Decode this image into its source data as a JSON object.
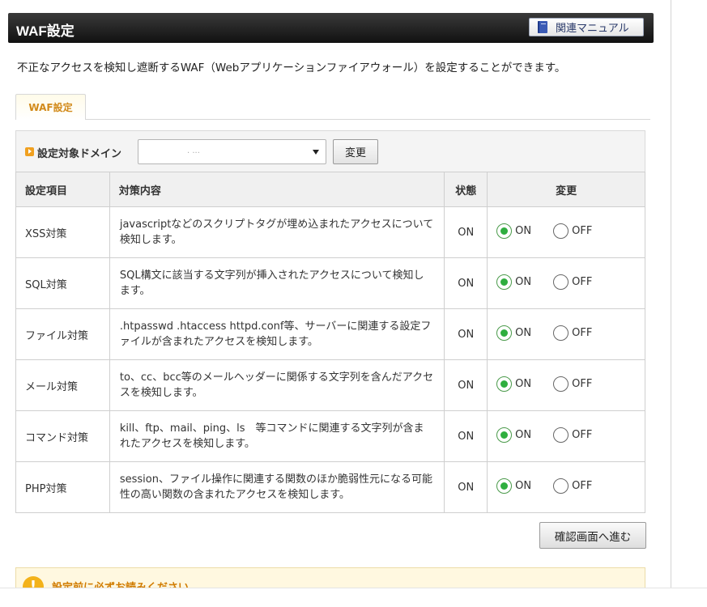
{
  "header": {
    "title": "WAF設定",
    "manual_button": "関連マニュアル"
  },
  "description": "不正なアクセスを検知し遮断するWAF（Webアプリケーションファイアウォール）を設定することができます。",
  "tab": {
    "label": "WAF設定"
  },
  "domain": {
    "label": "設定対象ドメイン",
    "selected": ". ...",
    "change_button": "変更"
  },
  "table": {
    "headers": [
      "設定項目",
      "対策内容",
      "状態",
      "変更"
    ],
    "rows": [
      {
        "item": "XSS対策",
        "desc": "javascriptなどのスクリプトタグが埋め込まれたアクセスについて検知します。",
        "status": "ON",
        "selected": "ON"
      },
      {
        "item": "SQL対策",
        "desc": "SQL構文に該当する文字列が挿入されたアクセスについて検知します。",
        "status": "ON",
        "selected": "ON"
      },
      {
        "item": "ファイル対策",
        "desc": ".htpasswd .htaccess httpd.conf等、サーバーに関連する設定ファイルが含まれたアクセスを検知します。",
        "status": "ON",
        "selected": "ON"
      },
      {
        "item": "メール対策",
        "desc": "to、cc、bcc等のメールヘッダーに関係する文字列を含んだアクセスを検知します。",
        "status": "ON",
        "selected": "ON"
      },
      {
        "item": "コマンド対策",
        "desc": "kill、ftp、mail、ping、ls　等コマンドに関連する文字列が含まれたアクセスを検知します。",
        "status": "ON",
        "selected": "ON"
      },
      {
        "item": "PHP対策",
        "desc": "session、ファイル操作に関連する関数のほか脆弱性元になる可能性の高い関数の含まれたアクセスを検知します。",
        "status": "ON",
        "selected": "ON"
      }
    ],
    "radio_on_label": "ON",
    "radio_off_label": "OFF"
  },
  "confirm_button": "確認画面へ進む",
  "notice": {
    "title": "設定前に必ずお読みください"
  },
  "colors": {
    "accent_orange": "#d28a1a",
    "radio_green": "#2fae3f",
    "header_dark": "#1a1a1a"
  },
  "icons": {
    "manual": "book-icon",
    "domain": "orange-arrow-icon",
    "notice": "warning-icon"
  }
}
